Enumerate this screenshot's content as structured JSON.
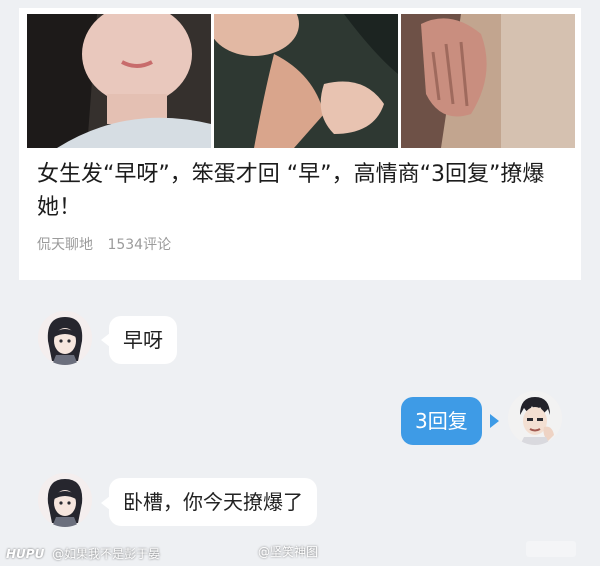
{
  "article": {
    "headline": "女生发“早呀”，笨蛋才回 “早”，高情商“3回复”撩爆她！",
    "source": "侃天聊地",
    "comments": "1534评论"
  },
  "chat": {
    "messages": [
      {
        "sender": "girl",
        "text": "早呀"
      },
      {
        "sender": "boy",
        "text": "3回复"
      },
      {
        "sender": "girl",
        "text": "卧槽，你今天撩爆了"
      }
    ]
  },
  "watermark": {
    "brand": "HUPU",
    "handle": "@如果我不是彭于晏",
    "center": "@坚笑神图"
  },
  "colors": {
    "chat_background": "#eef0f3",
    "right_bubble": "#3e9be6",
    "left_bubble": "#ffffff"
  }
}
